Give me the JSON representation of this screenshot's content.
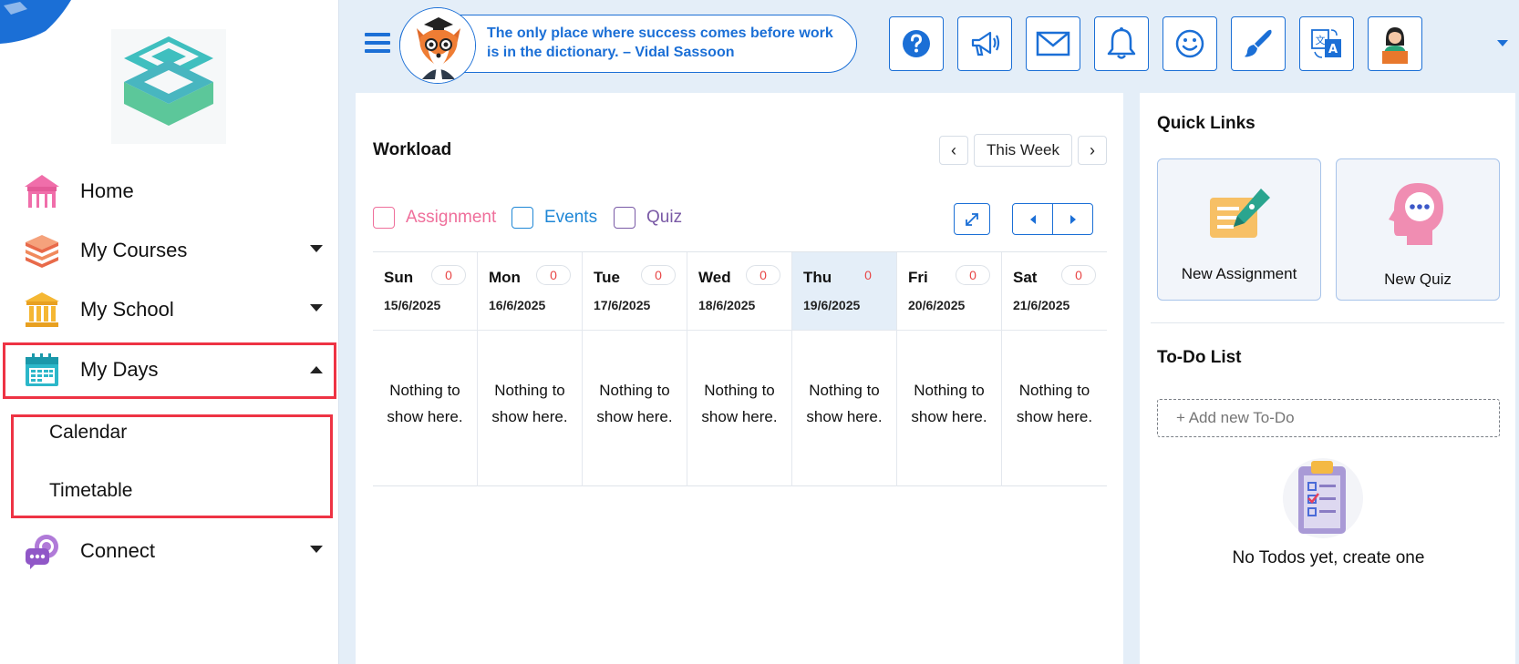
{
  "sidebar": {
    "items": [
      {
        "label": "Home",
        "icon": "home-icon",
        "has_caret": false
      },
      {
        "label": "My Courses",
        "icon": "book-stack-icon",
        "has_caret": true
      },
      {
        "label": "My School",
        "icon": "school-icon",
        "has_caret": true
      },
      {
        "label": "My Days",
        "icon": "calendar-icon",
        "has_caret": true,
        "expanded": true
      },
      {
        "label": "Connect",
        "icon": "chat-icon",
        "has_caret": true
      }
    ],
    "sub_items": [
      {
        "label": "Calendar"
      },
      {
        "label": "Timetable"
      }
    ]
  },
  "header": {
    "quote_line1": "The only place where success comes before work",
    "quote_line2": "is in the dictionary. – Vidal Sassoon",
    "buttons": [
      "help-icon",
      "megaphone-icon",
      "mail-icon",
      "bell-icon",
      "smiley-icon",
      "brush-icon",
      "translate-icon",
      "user-avatar-icon"
    ]
  },
  "workload": {
    "title": "Workload",
    "range_label": "This Week",
    "prev_symbol": "‹",
    "next_symbol": "›",
    "legend": [
      {
        "label": "Assignment",
        "color": "#ef6f9b"
      },
      {
        "label": "Events",
        "color": "#1f87d6"
      },
      {
        "label": "Quiz",
        "color": "#7a5aa6"
      }
    ],
    "days": [
      {
        "name": "Sun",
        "date": "15/6/2025",
        "count": "0",
        "empty_line1": "Nothing to",
        "empty_line2": "show here."
      },
      {
        "name": "Mon",
        "date": "16/6/2025",
        "count": "0",
        "empty_line1": "Nothing to",
        "empty_line2": "show here."
      },
      {
        "name": "Tue",
        "date": "17/6/2025",
        "count": "0",
        "empty_line1": "Nothing to",
        "empty_line2": "show here."
      },
      {
        "name": "Wed",
        "date": "18/6/2025",
        "count": "0",
        "empty_line1": "Nothing to",
        "empty_line2": "show here."
      },
      {
        "name": "Thu",
        "date": "19/6/2025",
        "count": "0",
        "empty_line1": "Nothing to",
        "empty_line2": "show here.",
        "today": true
      },
      {
        "name": "Fri",
        "date": "20/6/2025",
        "count": "0",
        "empty_line1": "Nothing to",
        "empty_line2": "show here."
      },
      {
        "name": "Sat",
        "date": "21/6/2025",
        "count": "0",
        "empty_line1": "Nothing to",
        "empty_line2": "show here."
      }
    ]
  },
  "quick_links": {
    "title": "Quick Links",
    "items": [
      {
        "label": "New Assignment",
        "icon": "assignment-pen-icon"
      },
      {
        "label": "New Quiz",
        "icon": "quiz-head-icon"
      }
    ]
  },
  "todo": {
    "title": "To-Do List",
    "placeholder": "+ Add new To-Do",
    "empty_text": "No Todos yet, create one"
  },
  "colors": {
    "accent": "#1b6fd6",
    "highlight": "#ee3344",
    "count": "#e84545",
    "today_bg": "#e4eef8"
  }
}
